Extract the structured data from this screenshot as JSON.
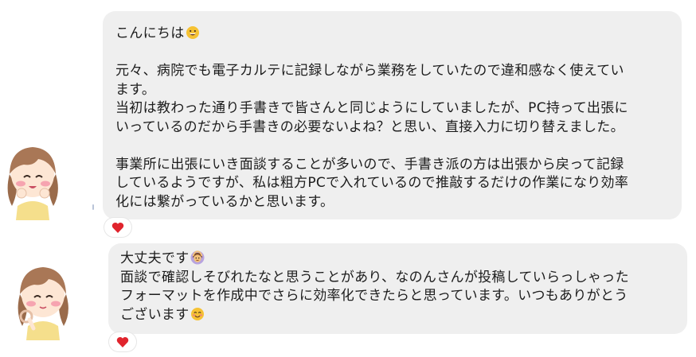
{
  "messages": [
    {
      "lines": [
        {
          "text": "こんにちは",
          "emoji": "grinning-face"
        },
        {
          "text": ""
        },
        {
          "text": "元々、病院でも電子カルテに記録しながら業務をしていたので違和感なく使えてい"
        },
        {
          "text": "ます。"
        },
        {
          "text": "当初は教わった通り手書きで皆さんと同じようにしていましたが、PC持って出張に"
        },
        {
          "text": "いっているのだから手書きの必要ないよね？と思い、直接入力に切り替えました。"
        },
        {
          "text": ""
        },
        {
          "text": "事業所に出張にいき面談することが多いので、手書き派の方は出張から戻って記録"
        },
        {
          "text": "しているようですが、私は粗方PCで入れているので推敲するだけの作業になり効率"
        },
        {
          "text": "化には繋がっているかと思います。"
        }
      ],
      "reaction": "red-heart"
    },
    {
      "lines": [
        {
          "text": "大丈夫です",
          "emoji": "person-gesturing-ok"
        },
        {
          "text": "面談で確認しそびれたなと思うことがあり、なのんさんが投稿していらっしゃった"
        },
        {
          "text": "フォーマットを作成中でさらに効率化できたらと思っています。いつもありがとう"
        },
        {
          "text": "ございます",
          "emoji": "smiling-face-with-smiling-eyes"
        }
      ],
      "reaction": "red-heart"
    }
  ],
  "colors": {
    "bubble": "#efefef",
    "text": "#1c1c1c",
    "heart": "#e0242d",
    "reaction_bg": "#ffffff"
  }
}
